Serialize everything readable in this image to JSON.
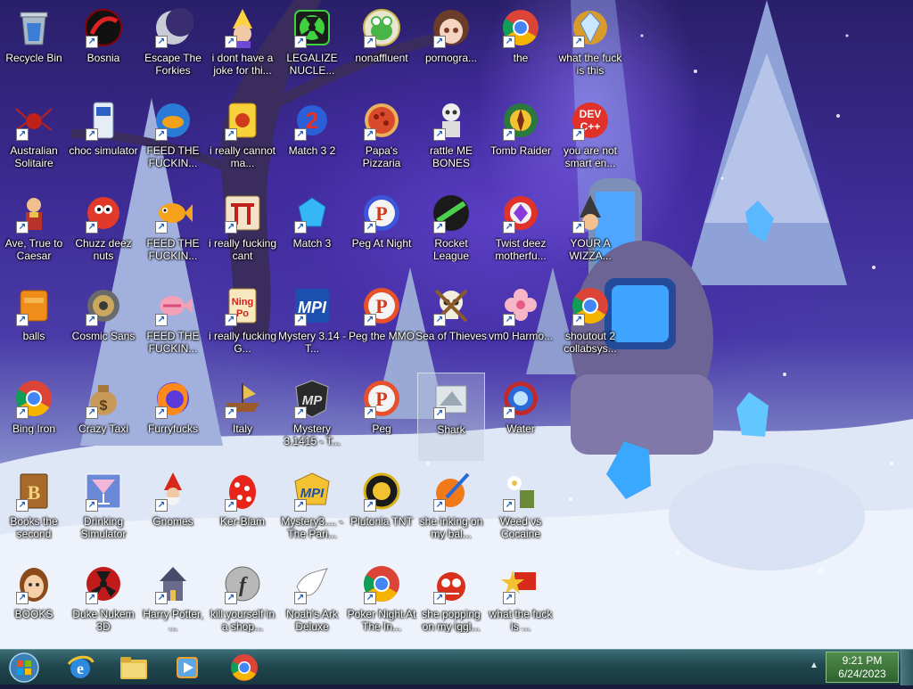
{
  "desktop": {
    "icons": [
      {
        "label": "Recycle Bin",
        "icon": "recycle-bin-icon",
        "shortcut": false
      },
      {
        "label": "Bosnia",
        "icon": "red-black-ball-icon",
        "shortcut": true
      },
      {
        "label": "Escape The Forkies",
        "icon": "moon-icon",
        "shortcut": true
      },
      {
        "label": "i dont have a joke for thi...",
        "icon": "wizard-icon",
        "shortcut": true
      },
      {
        "label": "LEGALIZE NUCLE...",
        "icon": "radiation-icon",
        "shortcut": true
      },
      {
        "label": "nonaffluent",
        "icon": "frog-icon",
        "shortcut": true
      },
      {
        "label": "pornogra...",
        "icon": "anime-girl-icon",
        "shortcut": true
      },
      {
        "label": "the",
        "icon": "chrome-icon",
        "shortcut": true
      },
      {
        "label": "what the fuck is this",
        "icon": "diamond-compass-icon",
        "shortcut": true
      },
      {
        "label": "Australian Solitaire",
        "icon": "spider-icon",
        "shortcut": true
      },
      {
        "label": "choc simulator",
        "icon": "phone-icon",
        "shortcut": true
      },
      {
        "label": "FEED THE FUCKIN...",
        "icon": "fish-tank-icon",
        "shortcut": true
      },
      {
        "label": "i really cannot ma...",
        "icon": "mahjong-icon",
        "shortcut": true
      },
      {
        "label": "Match 3 2",
        "icon": "match32-icon",
        "shortcut": true
      },
      {
        "label": "Papa's Pizzaria",
        "icon": "pizza-icon",
        "shortcut": true
      },
      {
        "label": "rattle ME BONES",
        "icon": "skeleton-icon",
        "shortcut": true
      },
      {
        "label": "Tomb Raider",
        "icon": "tomb-raider-icon",
        "shortcut": true
      },
      {
        "label": "you are not smart en...",
        "icon": "dev-cpp-icon",
        "shortcut": true
      },
      {
        "label": "Ave, True to Caesar",
        "icon": "roman-icon",
        "shortcut": true
      },
      {
        "label": "Chuzz deez nuts",
        "icon": "red-fuzzball-icon",
        "shortcut": true
      },
      {
        "label": "FEED THE FUCKIN...",
        "icon": "goldfish-icon",
        "shortcut": true
      },
      {
        "label": "i really fucking cant",
        "icon": "torii-icon",
        "shortcut": true
      },
      {
        "label": "Match 3",
        "icon": "blue-gem-icon",
        "shortcut": true
      },
      {
        "label": "Peg At Night",
        "icon": "peggle-night-icon",
        "shortcut": true
      },
      {
        "label": "Rocket League",
        "icon": "rocket-league-icon",
        "shortcut": true
      },
      {
        "label": "Twist deez motherfu...",
        "icon": "gem-ring-icon",
        "shortcut": true
      },
      {
        "label": "YOUR A WIZZA...",
        "icon": "wizard-hat-icon",
        "shortcut": true
      },
      {
        "label": "balls",
        "icon": "orange-block-icon",
        "shortcut": true
      },
      {
        "label": "Cosmic Sans",
        "icon": "gear-orb-icon",
        "shortcut": true
      },
      {
        "label": "FEED THE FUCKIN...",
        "icon": "tropical-fish-icon",
        "shortcut": true
      },
      {
        "label": "i really fucking G...",
        "icon": "ningpo-icon",
        "shortcut": true
      },
      {
        "label": "Mystery 3.14 - T...",
        "icon": "mpi-icon",
        "shortcut": true
      },
      {
        "label": "Peg the MMO",
        "icon": "peggle-icon",
        "shortcut": true
      },
      {
        "label": "Sea of Thieves",
        "icon": "skull-icon",
        "shortcut": true
      },
      {
        "label": "vm0 Harmo...",
        "icon": "flower-icon",
        "shortcut": true
      },
      {
        "label": "shoutout 2 collabsys...",
        "icon": "chrome-icon",
        "shortcut": true
      },
      {
        "label": "Bing Iron",
        "icon": "chrome-icon",
        "shortcut": true
      },
      {
        "label": "Crazy Taxi",
        "icon": "money-bag-icon",
        "shortcut": true
      },
      {
        "label": "Furryfucks",
        "icon": "firefox-icon",
        "shortcut": true
      },
      {
        "label": "Italy",
        "icon": "viking-ship-icon",
        "shortcut": true
      },
      {
        "label": "Mystery 3.1415 - T...",
        "icon": "mp-badge-icon",
        "shortcut": true
      },
      {
        "label": "Peg",
        "icon": "peggle-icon",
        "shortcut": true
      },
      {
        "label": "Shark",
        "icon": "shark-icon",
        "shortcut": true,
        "selected": true
      },
      {
        "label": "Water",
        "icon": "water-ring-icon",
        "shortcut": true
      },
      {
        "label": "Books the second",
        "icon": "book-icon",
        "shortcut": true
      },
      {
        "label": "Drinking Simulator",
        "icon": "cocktail-icon",
        "shortcut": true
      },
      {
        "label": "Gnomes",
        "icon": "gnome-icon",
        "shortcut": true
      },
      {
        "label": "Ker-Blam",
        "icon": "polka-egg-icon",
        "shortcut": true
      },
      {
        "label": "Mystery3.... - The Pari...",
        "icon": "mpi-gold-icon",
        "shortcut": true
      },
      {
        "label": "Plutonia TNT",
        "icon": "plutonia-icon",
        "shortcut": true
      },
      {
        "label": "she inking on my bal...",
        "icon": "paint-ball-icon",
        "shortcut": true
      },
      {
        "label": "Weed vs Cocaine",
        "icon": "plants-zombies-icon",
        "shortcut": true
      },
      {
        "label": "BOOKS",
        "icon": "girl-face-icon",
        "shortcut": true
      },
      {
        "label": "Duke Nukem 3D",
        "icon": "nuke-icon",
        "shortcut": true
      },
      {
        "label": "Harry Potter, ...",
        "icon": "house-icon",
        "shortcut": true
      },
      {
        "label": "kill yourself in a shop...",
        "icon": "flash-icon",
        "shortcut": true
      },
      {
        "label": "Noah's Ark Deluxe",
        "icon": "dove-icon",
        "shortcut": true
      },
      {
        "label": "Poker Night At The In...",
        "icon": "chrome-icon",
        "shortcut": true
      },
      {
        "label": "she popping on my iggl...",
        "icon": "bug-face-icon",
        "shortcut": true
      },
      {
        "label": "what the fuck is ...",
        "icon": "star-box-icon",
        "shortcut": true
      }
    ]
  },
  "taskbar": {
    "pinned": [
      {
        "name": "internet-explorer",
        "icon": "internet-explorer-icon"
      },
      {
        "name": "file-explorer",
        "icon": "folder-icon"
      },
      {
        "name": "media-player",
        "icon": "media-player-icon"
      },
      {
        "name": "chrome",
        "icon": "chrome-icon"
      }
    ],
    "clock": {
      "time": "9:21 PM",
      "date": "6/24/2023"
    }
  }
}
